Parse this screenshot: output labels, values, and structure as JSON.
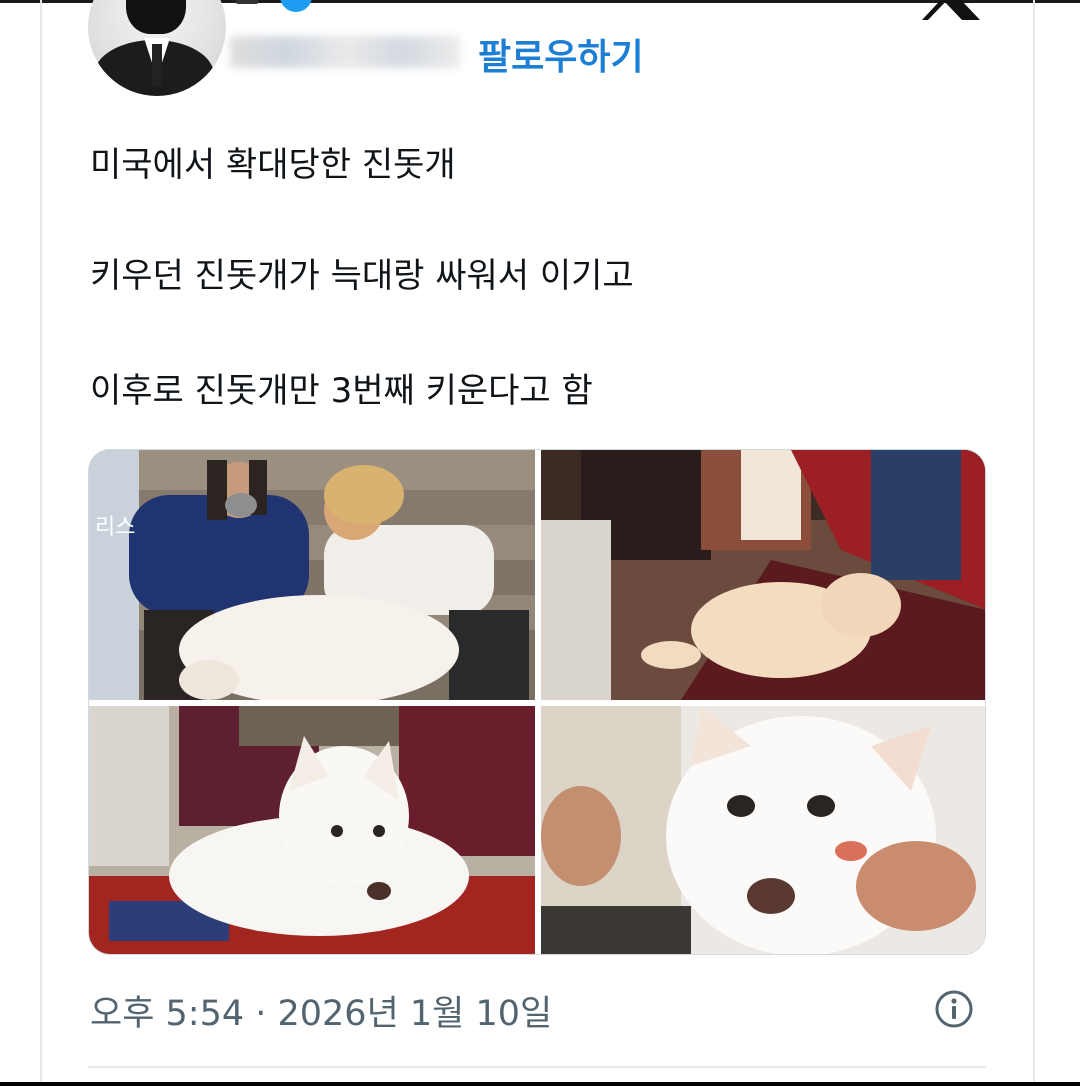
{
  "header": {
    "follow_label": "팔로우하기",
    "verified_color": "#1d9bf0",
    "logo_icon": "x-logo-icon"
  },
  "tweet": {
    "lines": [
      "미국에서 확대당한 진돗개",
      "키우던 진돗개가 늑대랑 싸워서 이기고",
      "이후로 진돗개만 3번째 키운다고 함"
    ]
  },
  "media": {
    "photo_count": 4,
    "photos": [
      {
        "desc_icon": "couple-with-dog-photo",
        "overlay_text": "리스"
      },
      {
        "desc_icon": "dog-on-rug-photo"
      },
      {
        "desc_icon": "white-dog-lying-photo"
      },
      {
        "desc_icon": "white-dog-closeup-photo"
      }
    ]
  },
  "footer": {
    "timestamp": "오후 5:54 · 2026년 1월 10일",
    "info_icon": "info-icon"
  },
  "colors": {
    "link": "#1d7fd4",
    "text": "#0f1419",
    "muted": "#536471"
  }
}
